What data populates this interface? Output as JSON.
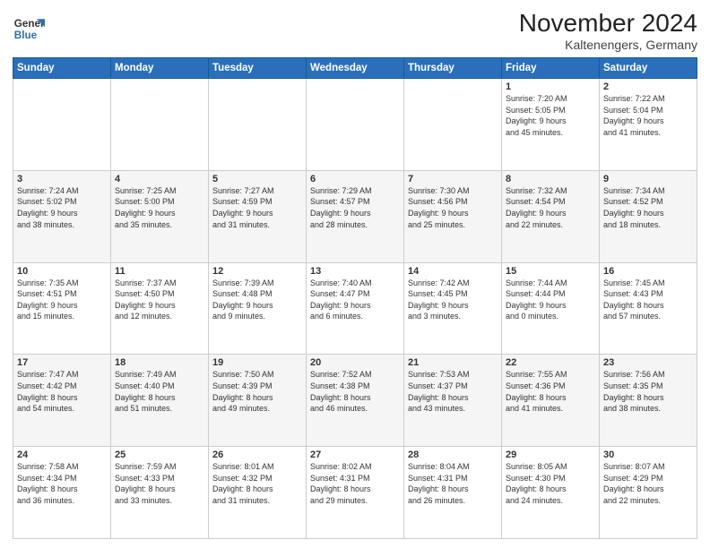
{
  "logo": {
    "line1": "General",
    "line2": "Blue"
  },
  "header": {
    "month": "November 2024",
    "location": "Kaltenengers, Germany"
  },
  "weekdays": [
    "Sunday",
    "Monday",
    "Tuesday",
    "Wednesday",
    "Thursday",
    "Friday",
    "Saturday"
  ],
  "weeks": [
    [
      {
        "day": "",
        "info": ""
      },
      {
        "day": "",
        "info": ""
      },
      {
        "day": "",
        "info": ""
      },
      {
        "day": "",
        "info": ""
      },
      {
        "day": "",
        "info": ""
      },
      {
        "day": "1",
        "info": "Sunrise: 7:20 AM\nSunset: 5:05 PM\nDaylight: 9 hours\nand 45 minutes."
      },
      {
        "day": "2",
        "info": "Sunrise: 7:22 AM\nSunset: 5:04 PM\nDaylight: 9 hours\nand 41 minutes."
      }
    ],
    [
      {
        "day": "3",
        "info": "Sunrise: 7:24 AM\nSunset: 5:02 PM\nDaylight: 9 hours\nand 38 minutes."
      },
      {
        "day": "4",
        "info": "Sunrise: 7:25 AM\nSunset: 5:00 PM\nDaylight: 9 hours\nand 35 minutes."
      },
      {
        "day": "5",
        "info": "Sunrise: 7:27 AM\nSunset: 4:59 PM\nDaylight: 9 hours\nand 31 minutes."
      },
      {
        "day": "6",
        "info": "Sunrise: 7:29 AM\nSunset: 4:57 PM\nDaylight: 9 hours\nand 28 minutes."
      },
      {
        "day": "7",
        "info": "Sunrise: 7:30 AM\nSunset: 4:56 PM\nDaylight: 9 hours\nand 25 minutes."
      },
      {
        "day": "8",
        "info": "Sunrise: 7:32 AM\nSunset: 4:54 PM\nDaylight: 9 hours\nand 22 minutes."
      },
      {
        "day": "9",
        "info": "Sunrise: 7:34 AM\nSunset: 4:52 PM\nDaylight: 9 hours\nand 18 minutes."
      }
    ],
    [
      {
        "day": "10",
        "info": "Sunrise: 7:35 AM\nSunset: 4:51 PM\nDaylight: 9 hours\nand 15 minutes."
      },
      {
        "day": "11",
        "info": "Sunrise: 7:37 AM\nSunset: 4:50 PM\nDaylight: 9 hours\nand 12 minutes."
      },
      {
        "day": "12",
        "info": "Sunrise: 7:39 AM\nSunset: 4:48 PM\nDaylight: 9 hours\nand 9 minutes."
      },
      {
        "day": "13",
        "info": "Sunrise: 7:40 AM\nSunset: 4:47 PM\nDaylight: 9 hours\nand 6 minutes."
      },
      {
        "day": "14",
        "info": "Sunrise: 7:42 AM\nSunset: 4:45 PM\nDaylight: 9 hours\nand 3 minutes."
      },
      {
        "day": "15",
        "info": "Sunrise: 7:44 AM\nSunset: 4:44 PM\nDaylight: 9 hours\nand 0 minutes."
      },
      {
        "day": "16",
        "info": "Sunrise: 7:45 AM\nSunset: 4:43 PM\nDaylight: 8 hours\nand 57 minutes."
      }
    ],
    [
      {
        "day": "17",
        "info": "Sunrise: 7:47 AM\nSunset: 4:42 PM\nDaylight: 8 hours\nand 54 minutes."
      },
      {
        "day": "18",
        "info": "Sunrise: 7:49 AM\nSunset: 4:40 PM\nDaylight: 8 hours\nand 51 minutes."
      },
      {
        "day": "19",
        "info": "Sunrise: 7:50 AM\nSunset: 4:39 PM\nDaylight: 8 hours\nand 49 minutes."
      },
      {
        "day": "20",
        "info": "Sunrise: 7:52 AM\nSunset: 4:38 PM\nDaylight: 8 hours\nand 46 minutes."
      },
      {
        "day": "21",
        "info": "Sunrise: 7:53 AM\nSunset: 4:37 PM\nDaylight: 8 hours\nand 43 minutes."
      },
      {
        "day": "22",
        "info": "Sunrise: 7:55 AM\nSunset: 4:36 PM\nDaylight: 8 hours\nand 41 minutes."
      },
      {
        "day": "23",
        "info": "Sunrise: 7:56 AM\nSunset: 4:35 PM\nDaylight: 8 hours\nand 38 minutes."
      }
    ],
    [
      {
        "day": "24",
        "info": "Sunrise: 7:58 AM\nSunset: 4:34 PM\nDaylight: 8 hours\nand 36 minutes."
      },
      {
        "day": "25",
        "info": "Sunrise: 7:59 AM\nSunset: 4:33 PM\nDaylight: 8 hours\nand 33 minutes."
      },
      {
        "day": "26",
        "info": "Sunrise: 8:01 AM\nSunset: 4:32 PM\nDaylight: 8 hours\nand 31 minutes."
      },
      {
        "day": "27",
        "info": "Sunrise: 8:02 AM\nSunset: 4:31 PM\nDaylight: 8 hours\nand 29 minutes."
      },
      {
        "day": "28",
        "info": "Sunrise: 8:04 AM\nSunset: 4:31 PM\nDaylight: 8 hours\nand 26 minutes."
      },
      {
        "day": "29",
        "info": "Sunrise: 8:05 AM\nSunset: 4:30 PM\nDaylight: 8 hours\nand 24 minutes."
      },
      {
        "day": "30",
        "info": "Sunrise: 8:07 AM\nSunset: 4:29 PM\nDaylight: 8 hours\nand 22 minutes."
      }
    ]
  ]
}
